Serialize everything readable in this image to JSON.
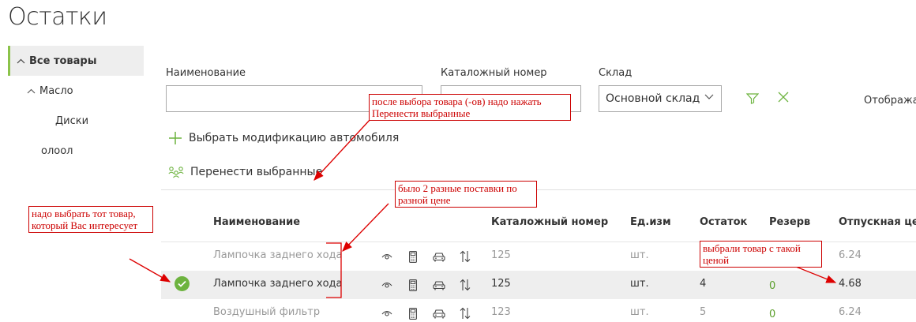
{
  "page": {
    "title": "Остатки"
  },
  "sidebar": {
    "items": [
      {
        "label": "Все товары",
        "chevron": "chevron-up-icon"
      },
      {
        "label": "Масло",
        "chevron": "chevron-up-icon"
      },
      {
        "label": "Диски"
      },
      {
        "label": "олоол"
      }
    ]
  },
  "filters": {
    "name_label": "Наименование",
    "name_value": "",
    "catalog_label": "Каталожный номер",
    "catalog_value": "",
    "warehouse_label": "Склад",
    "warehouse_value": "Основной склад",
    "display_label": "Отобража"
  },
  "actions": {
    "select_modification": "Выбрать модификацию автомобиля",
    "transfer_selected": "Перенести выбранные"
  },
  "table": {
    "headers": [
      "Наименование",
      "Каталожный номер",
      "Ед.изм",
      "Остаток",
      "Резерв",
      "Отпускная цен"
    ],
    "rows": [
      {
        "name": "Лампочка заднего хода",
        "catalog": "125",
        "unit": "шт.",
        "stock": "",
        "reserve": "",
        "price": "6.24",
        "selected": false
      },
      {
        "name": "Лампочка заднего хода",
        "catalog": "125",
        "unit": "шт.",
        "stock": "4",
        "reserve": "0",
        "price": "4.68",
        "selected": true
      },
      {
        "name": "Воздушный фильтр",
        "catalog": "123",
        "unit": "шт.",
        "stock": "5",
        "reserve": "0",
        "price": "6.24",
        "selected": false
      }
    ]
  },
  "annotations": {
    "note1": "после выбора товара (-ов) надо нажать Перенести выбранные",
    "note2": "было 2 разные поставки по разной цене",
    "note3": "надо выбрать тот товар, который Вас интересует",
    "note4": "выбрали товар с такой ценой"
  },
  "colors": {
    "accent": "#8bc34a",
    "check": "#6db33f",
    "annotation": "#cc0000"
  }
}
